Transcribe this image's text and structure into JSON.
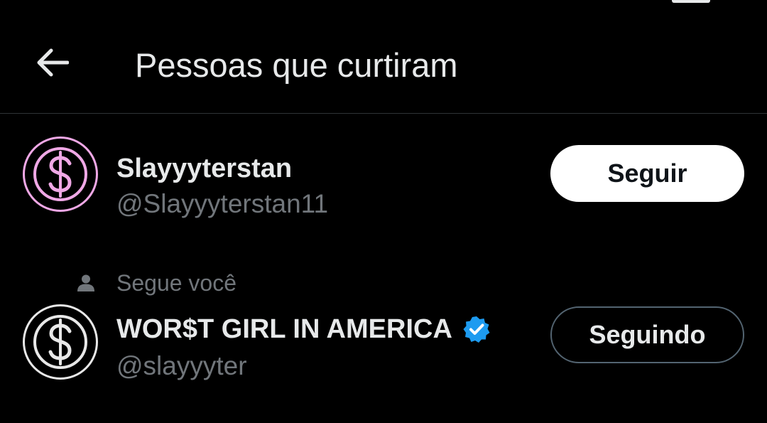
{
  "header": {
    "title": "Pessoas que curtiram",
    "back_icon": "arrow-left-icon"
  },
  "users": [
    {
      "display_name": "Slayyyterstan",
      "handle": "@Slayyyterstan11",
      "avatar_icon": "dollar-sign-icon",
      "avatar_color": "#f0a8e6",
      "button_label": "Seguir",
      "verified": false
    },
    {
      "social_context": "Segue você",
      "social_icon": "person-icon",
      "display_name": "WOR$T GIRL IN AMERICA",
      "handle": "@slayyyter",
      "avatar_icon": "dollar-sign-icon",
      "avatar_color": "#e8e8e8",
      "verified_icon": "verified-badge-icon",
      "verified_color": "#1d9bf0",
      "verified": true,
      "button_label": "Seguindo"
    }
  ],
  "colors": {
    "background": "#000000",
    "text_primary": "#e7e9ea",
    "text_secondary": "#71767b",
    "divider": "#2f3336"
  }
}
